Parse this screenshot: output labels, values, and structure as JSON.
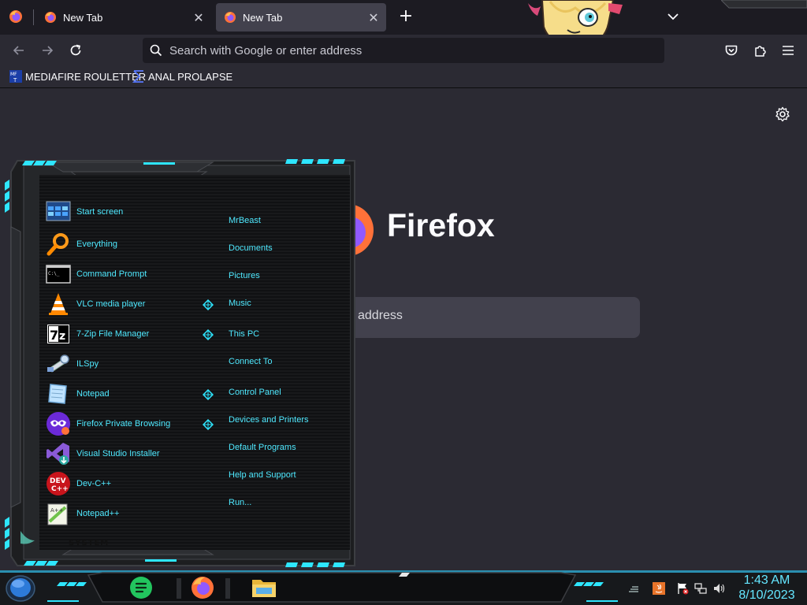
{
  "browser": {
    "tabs": [
      {
        "label": "New Tab",
        "active": false
      },
      {
        "label": "New Tab",
        "active": true
      }
    ],
    "new_tab_icon": "plus-icon",
    "tab_list_icon": "chevron-down-icon",
    "url_placeholder": "Search with Google or enter address",
    "nav_icons": [
      "back-arrow-icon",
      "forward-arrow-icon",
      "reload-icon",
      "pocket-icon",
      "extensions-icon",
      "hamburger-menu-icon"
    ],
    "bookmarks": [
      {
        "label": "MEDIAFIRE ROULETTER",
        "icon": "mediafire-icon"
      },
      {
        "label": "ANAL PROLAPSE",
        "icon": "sigma-icon"
      }
    ]
  },
  "newtab": {
    "wordmark": "Firefox",
    "search_placeholder_visible": "address",
    "settings_icon": "gear-icon"
  },
  "start_menu": {
    "programs": [
      {
        "label": "Start screen",
        "icon": "start-screen-icon"
      },
      {
        "label": "Everything",
        "icon": "magnifier-icon"
      },
      {
        "label": "Command Prompt",
        "icon": "cmd-icon"
      },
      {
        "label": "VLC media player",
        "icon": "vlc-cone-icon"
      },
      {
        "label": "7-Zip File Manager",
        "icon": "7zip-icon"
      },
      {
        "label": "ILSpy",
        "icon": "ilspy-icon"
      },
      {
        "label": "Notepad",
        "icon": "notepad-icon"
      },
      {
        "label": "Firefox Private Browsing",
        "icon": "private-browsing-icon"
      },
      {
        "label": "Visual Studio Installer",
        "icon": "vs-installer-icon"
      },
      {
        "label": "Dev-C++",
        "icon": "devcpp-icon"
      },
      {
        "label": "Notepad++",
        "icon": "notepadpp-icon"
      }
    ],
    "places": [
      "MrBeast",
      "Documents",
      "Pictures",
      "Music",
      "This PC",
      "Connect To",
      "Control Panel",
      "Devices and Printers",
      "Default Programs",
      "Help and Support",
      "Run..."
    ],
    "system_label": "SYSTEM",
    "accent": "#2ee6ff"
  },
  "taskbar": {
    "apps": [
      "notes-app-icon",
      "firefox-icon",
      "file-explorer-icon"
    ],
    "tray_icons": [
      "show-hidden-icon",
      "java-icon",
      "action-center-flag-icon",
      "network-icon",
      "volume-icon"
    ],
    "time": "1:43 AM",
    "date": "8/10/2023"
  }
}
